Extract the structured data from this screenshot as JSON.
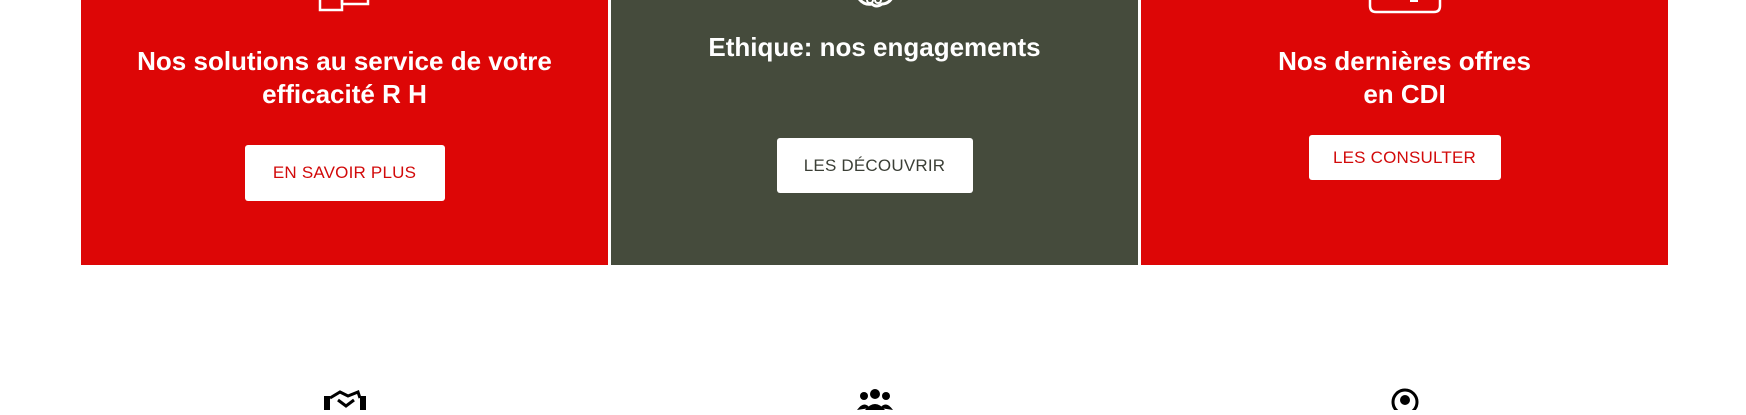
{
  "panels": [
    {
      "title_line1": "Nos solutions au service de votre",
      "title_line2": "efficacité R H",
      "button": "EN SAVOIR PLUS",
      "icon": "documents-icon"
    },
    {
      "title_line1": "Ethique: nos engagements",
      "button": "LES DÉCOUVRIR",
      "icon": "handshake-icon"
    },
    {
      "title_line1": "Nos dernières offres",
      "title_line2": "en CDI",
      "button": "LES CONSULTER",
      "icon": "briefcase-icon"
    }
  ],
  "colors": {
    "red": "#dd0606",
    "dark": "#454b3c",
    "white": "#ffffff"
  },
  "bottom_icons": [
    "handshake-icon",
    "team-icon",
    "user-icon"
  ]
}
